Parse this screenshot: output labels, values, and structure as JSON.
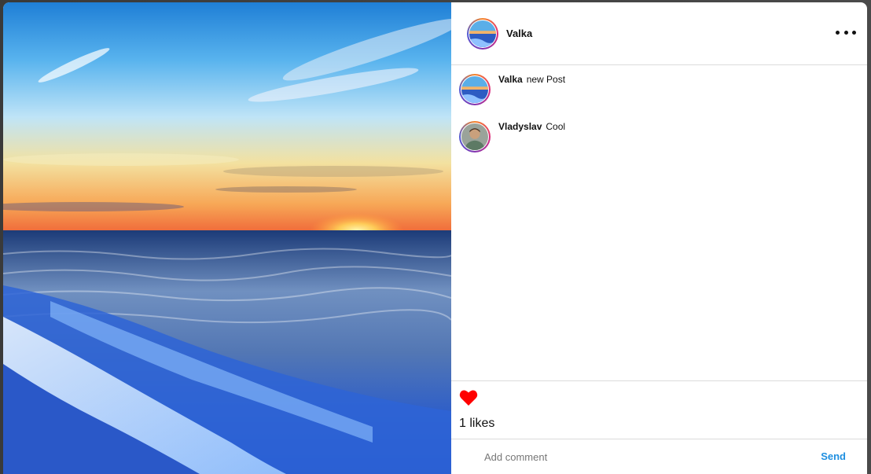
{
  "post": {
    "author": "Valka",
    "image_icon": "ocean-sunset-photo"
  },
  "header": {
    "username": "Valka",
    "more_icon": "more-horizontal-icon"
  },
  "comments": [
    {
      "author": "Valka",
      "text": "new Post",
      "avatar": "ocean-avatar"
    },
    {
      "author": "Vladyslav",
      "text": "Cool",
      "avatar": "person-avatar"
    }
  ],
  "actions": {
    "like_icon": "heart-icon",
    "liked": true,
    "likes_text": "1 likes"
  },
  "comment_bar": {
    "placeholder": "Add comment",
    "value": "",
    "send_label": "Send"
  },
  "colors": {
    "heart": "#ff0000",
    "send": "#1f8fe0",
    "divider": "#dbdbdb"
  }
}
